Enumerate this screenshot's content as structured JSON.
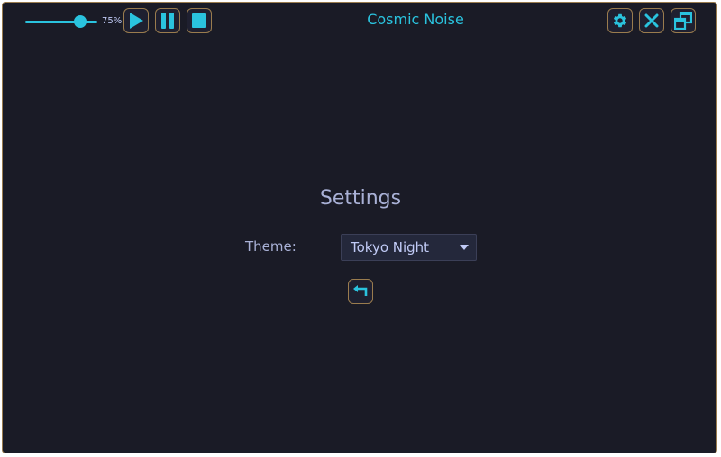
{
  "app": {
    "title": "Cosmic Noise"
  },
  "volume": {
    "level": 0.75,
    "label": "75%"
  },
  "controls": {
    "play_icon": "play-icon",
    "pause_icon": "pause-icon",
    "stop_icon": "stop-icon",
    "settings_icon": "gear-icon",
    "close_icon": "close-icon",
    "restore_icon": "restore-window-icon"
  },
  "settings": {
    "heading": "Settings",
    "theme_label": "Theme:",
    "theme_value": "Tokyo Night",
    "back_icon": "return-icon"
  },
  "colors": {
    "background": "#1a1b26",
    "accent": "#2ac3de",
    "border": "#9a7c4e",
    "text": "#a9b1d6"
  }
}
